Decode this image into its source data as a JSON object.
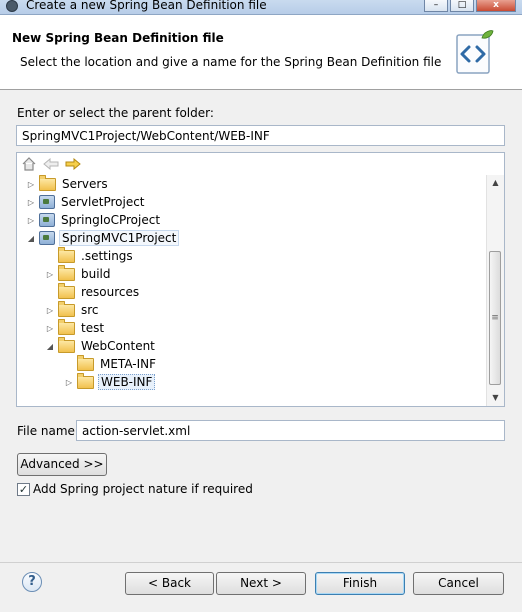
{
  "window": {
    "title": "Create a new Spring Bean Definition file",
    "minimize": "–",
    "maximize": "□",
    "close": "x"
  },
  "header": {
    "title": "New Spring Bean Definition file",
    "subtitle": "Select the location and give a name for the Spring Bean Definition file",
    "logo_icon": "spring-bean-xml-icon"
  },
  "parent_folder": {
    "label": "Enter or select the parent folder:",
    "value": "SpringMVC1Project/WebContent/WEB-INF"
  },
  "tree_toolbar": {
    "home_icon": "home-icon",
    "back_icon": "back-arrow-icon",
    "forward_icon": "forward-arrow-icon"
  },
  "tree": [
    {
      "label": "Servers",
      "type": "folder",
      "state": "collapsed"
    },
    {
      "label": "ServletProject",
      "type": "project",
      "state": "collapsed"
    },
    {
      "label": "SpringIoCProject",
      "type": "project",
      "state": "collapsed"
    },
    {
      "label": "SpringMVC1Project",
      "type": "project",
      "state": "expanded"
    },
    {
      "label": ".settings",
      "type": "folder",
      "state": "leaf"
    },
    {
      "label": "build",
      "type": "folder",
      "state": "collapsed"
    },
    {
      "label": "resources",
      "type": "folder",
      "state": "leaf"
    },
    {
      "label": "src",
      "type": "folder",
      "state": "collapsed"
    },
    {
      "label": "test",
      "type": "folder",
      "state": "collapsed"
    },
    {
      "label": "WebContent",
      "type": "folder",
      "state": "expanded"
    },
    {
      "label": "META-INF",
      "type": "folder",
      "state": "leaf"
    },
    {
      "label": "WEB-INF",
      "type": "folder",
      "state": "collapsed",
      "selected": true
    }
  ],
  "file_name": {
    "label": "File name:",
    "value": "action-servlet.xml"
  },
  "advanced_button": "Advanced >>",
  "spring_nature": {
    "label": "Add Spring project nature if required",
    "checked": true
  },
  "buttons": {
    "help": "?",
    "back": "< Back",
    "next": "Next >",
    "finish": "Finish",
    "cancel": "Cancel"
  },
  "colors": {
    "accent": "#3c7fb1",
    "folder": "#f1c14e",
    "background": "#f0f0f0"
  }
}
